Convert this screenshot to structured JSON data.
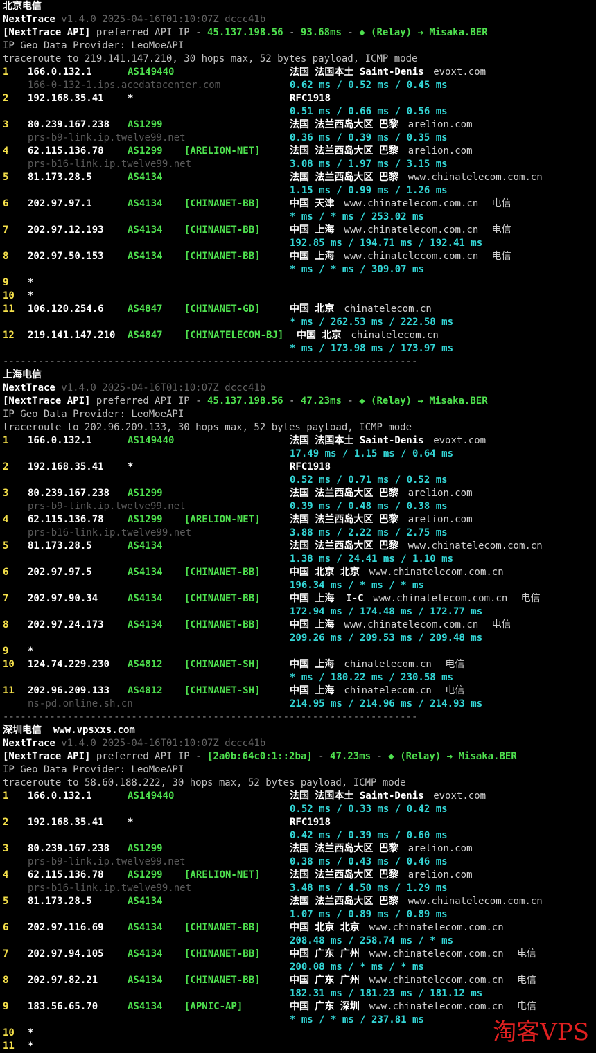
{
  "header": {
    "tool": "NextTrace",
    "version": "v1.4.0 2025-04-16T01:10:07Z dccc41b",
    "geo_provider": "IP Geo Data Provider: LeoMoeAPI"
  },
  "sections": [
    {
      "title": "北京电信",
      "site": "",
      "api_ip": "45.137.198.56",
      "api_latency": "93.68ms",
      "traceroute": "traceroute to 219.141.147.210, 30 hops max, 52 bytes payload, ICMP mode",
      "hops": [
        {
          "n": "1",
          "ip": "166.0.132.1",
          "asn": "AS149440",
          "tag": "",
          "geo": "法国 法国本土 Saint-Denis",
          "dom": "evoxt.com",
          "isp": "",
          "host": "166-0-132-1.ips.acedatacenter.com",
          "rtt": "0.62 ms / 0.52 ms / 0.45 ms"
        },
        {
          "n": "2",
          "ip": "192.168.35.41",
          "asn": "*",
          "tag": "",
          "geo": "RFC1918",
          "dom": "",
          "isp": "",
          "host": "",
          "rtt": "0.51 ms / 0.66 ms / 0.56 ms"
        },
        {
          "n": "3",
          "ip": "80.239.167.238",
          "asn": "AS1299",
          "tag": "",
          "geo": "法国 法兰西岛大区 巴黎",
          "dom": "arelion.com",
          "isp": "",
          "host": "prs-b9-link.ip.twelve99.net",
          "rtt": "0.36 ms / 0.39 ms / 0.35 ms"
        },
        {
          "n": "4",
          "ip": "62.115.136.78",
          "asn": "AS1299",
          "tag": "[ARELION-NET]",
          "geo": "法国 法兰西岛大区 巴黎",
          "dom": "arelion.com",
          "isp": "",
          "host": "prs-b16-link.ip.twelve99.net",
          "rtt": "3.08 ms / 1.97 ms / 3.15 ms"
        },
        {
          "n": "5",
          "ip": "81.173.28.5",
          "asn": "AS4134",
          "tag": "",
          "geo": "法国 法兰西岛大区 巴黎",
          "dom": "www.chinatelecom.com.cn",
          "isp": "",
          "host": "",
          "rtt": "1.15 ms / 0.99 ms / 1.26 ms"
        },
        {
          "n": "6",
          "ip": "202.97.97.1",
          "asn": "AS4134",
          "tag": "[CHINANET-BB]",
          "geo": "中国 天津",
          "dom": "www.chinatelecom.com.cn",
          "isp": "电信",
          "host": "",
          "rtt": "* ms / * ms / 253.02 ms"
        },
        {
          "n": "7",
          "ip": "202.97.12.193",
          "asn": "AS4134",
          "tag": "[CHINANET-BB]",
          "geo": "中国 上海",
          "dom": "www.chinatelecom.com.cn",
          "isp": "电信",
          "host": "",
          "rtt": "192.85 ms / 194.71 ms / 192.41 ms"
        },
        {
          "n": "8",
          "ip": "202.97.50.153",
          "asn": "AS4134",
          "tag": "[CHINANET-BB]",
          "geo": "中国 上海",
          "dom": "www.chinatelecom.com.cn",
          "isp": "电信",
          "host": "",
          "rtt": "* ms / * ms / 309.07 ms"
        },
        {
          "n": "9",
          "ip": "*"
        },
        {
          "n": "10",
          "ip": "*"
        },
        {
          "n": "11",
          "ip": "106.120.254.6",
          "asn": "AS4847",
          "tag": "[CHINANET-GD]",
          "geo": "中国 北京",
          "dom": "chinatelecom.cn",
          "isp": "",
          "host": "",
          "rtt": "* ms / 262.53 ms / 222.58 ms"
        },
        {
          "n": "12",
          "ip": "219.141.147.210",
          "asn": "AS4847",
          "tag": "[CHINATELECOM-BJ]",
          "geo": "中国 北京",
          "dom": "chinatelecom.cn",
          "isp": "",
          "host": "",
          "rtt": "* ms / 173.98 ms / 173.97 ms"
        }
      ]
    },
    {
      "title": "上海电信",
      "site": "",
      "api_ip": "45.137.198.56",
      "api_latency": "47.23ms",
      "traceroute": "traceroute to 202.96.209.133, 30 hops max, 52 bytes payload, ICMP mode",
      "hops": [
        {
          "n": "1",
          "ip": "166.0.132.1",
          "asn": "AS149440",
          "tag": "",
          "geo": "法国 法国本土 Saint-Denis",
          "dom": "evoxt.com",
          "isp": "",
          "host": "",
          "rtt": "17.49 ms / 1.15 ms / 0.64 ms"
        },
        {
          "n": "2",
          "ip": "192.168.35.41",
          "asn": "*",
          "tag": "",
          "geo": "RFC1918",
          "dom": "",
          "isp": "",
          "host": "",
          "rtt": "0.52 ms / 0.71 ms / 0.52 ms"
        },
        {
          "n": "3",
          "ip": "80.239.167.238",
          "asn": "AS1299",
          "tag": "",
          "geo": "法国 法兰西岛大区 巴黎",
          "dom": "arelion.com",
          "isp": "",
          "host": "prs-b9-link.ip.twelve99.net",
          "rtt": "0.39 ms / 0.48 ms / 0.38 ms"
        },
        {
          "n": "4",
          "ip": "62.115.136.78",
          "asn": "AS1299",
          "tag": "[ARELION-NET]",
          "geo": "法国 法兰西岛大区 巴黎",
          "dom": "arelion.com",
          "isp": "",
          "host": "prs-b16-link.ip.twelve99.net",
          "rtt": "3.88 ms / 2.22 ms / 2.75 ms"
        },
        {
          "n": "5",
          "ip": "81.173.28.5",
          "asn": "AS4134",
          "tag": "",
          "geo": "法国 法兰西岛大区 巴黎",
          "dom": "www.chinatelecom.com.cn",
          "isp": "",
          "host": "",
          "rtt": "1.38 ms / 24.41 ms / 1.10 ms"
        },
        {
          "n": "6",
          "ip": "202.97.97.5",
          "asn": "AS4134",
          "tag": "[CHINANET-BB]",
          "geo": "中国 北京 北京",
          "dom": "www.chinatelecom.com.cn",
          "isp": "",
          "host": "",
          "rtt": "196.34 ms / * ms / * ms"
        },
        {
          "n": "7",
          "ip": "202.97.90.34",
          "asn": "AS4134",
          "tag": "[CHINANET-BB]",
          "geo": "中国 上海  I-C",
          "dom": "www.chinatelecom.com.cn",
          "isp": "电信",
          "host": "",
          "rtt": "172.94 ms / 174.48 ms / 172.77 ms"
        },
        {
          "n": "8",
          "ip": "202.97.24.173",
          "asn": "AS4134",
          "tag": "[CHINANET-BB]",
          "geo": "中国 上海",
          "dom": "www.chinatelecom.com.cn",
          "isp": "电信",
          "host": "",
          "rtt": "209.26 ms / 209.53 ms / 209.48 ms"
        },
        {
          "n": "9",
          "ip": "*"
        },
        {
          "n": "10",
          "ip": "124.74.229.230",
          "asn": "AS4812",
          "tag": "[CHINANET-SH]",
          "geo": "中国 上海",
          "dom": "chinatelecom.cn",
          "isp": "电信",
          "host": "",
          "rtt": "* ms / 180.22 ms / 230.58 ms"
        },
        {
          "n": "11",
          "ip": "202.96.209.133",
          "asn": "AS4812",
          "tag": "[CHINANET-SH]",
          "geo": "中国 上海",
          "dom": "chinatelecom.cn",
          "isp": "电信",
          "host": "ns-pd.online.sh.cn",
          "rtt": "214.95 ms / 214.96 ms / 214.93 ms"
        }
      ]
    },
    {
      "title": "深圳电信",
      "site": "www.vpsxxs.com",
      "api_ip": "[2a0b:64c0:1::2ba]",
      "api_latency": "47.23ms",
      "traceroute": "traceroute to 58.60.188.222, 30 hops max, 52 bytes payload, ICMP mode",
      "hops": [
        {
          "n": "1",
          "ip": "166.0.132.1",
          "asn": "AS149440",
          "tag": "",
          "geo": "法国 法国本土 Saint-Denis",
          "dom": "evoxt.com",
          "isp": "",
          "host": "",
          "rtt": "0.52 ms / 0.33 ms / 0.42 ms"
        },
        {
          "n": "2",
          "ip": "192.168.35.41",
          "asn": "*",
          "tag": "",
          "geo": "RFC1918",
          "dom": "",
          "isp": "",
          "host": "",
          "rtt": "0.42 ms / 0.39 ms / 0.60 ms"
        },
        {
          "n": "3",
          "ip": "80.239.167.238",
          "asn": "AS1299",
          "tag": "",
          "geo": "法国 法兰西岛大区 巴黎",
          "dom": "arelion.com",
          "isp": "",
          "host": "prs-b9-link.ip.twelve99.net",
          "rtt": "0.38 ms / 0.43 ms / 0.46 ms"
        },
        {
          "n": "4",
          "ip": "62.115.136.78",
          "asn": "AS1299",
          "tag": "[ARELION-NET]",
          "geo": "法国 法兰西岛大区 巴黎",
          "dom": "arelion.com",
          "isp": "",
          "host": "prs-b16-link.ip.twelve99.net",
          "rtt": "3.48 ms / 4.50 ms / 1.29 ms"
        },
        {
          "n": "5",
          "ip": "81.173.28.5",
          "asn": "AS4134",
          "tag": "",
          "geo": "法国 法兰西岛大区 巴黎",
          "dom": "www.chinatelecom.com.cn",
          "isp": "",
          "host": "",
          "rtt": "1.07 ms / 0.89 ms / 0.89 ms"
        },
        {
          "n": "6",
          "ip": "202.97.116.69",
          "asn": "AS4134",
          "tag": "[CHINANET-BB]",
          "geo": "中国 北京 北京",
          "dom": "www.chinatelecom.com.cn",
          "isp": "",
          "host": "",
          "rtt": "208.48 ms / 258.74 ms / * ms"
        },
        {
          "n": "7",
          "ip": "202.97.94.105",
          "asn": "AS4134",
          "tag": "[CHINANET-BB]",
          "geo": "中国 广东 广州",
          "dom": "www.chinatelecom.com.cn",
          "isp": "电信",
          "host": "",
          "rtt": "200.08 ms / * ms / * ms"
        },
        {
          "n": "8",
          "ip": "202.97.82.21",
          "asn": "AS4134",
          "tag": "[CHINANET-BB]",
          "geo": "中国 广东 广州",
          "dom": "www.chinatelecom.com.cn",
          "isp": "电信",
          "host": "",
          "rtt": "182.31 ms / 181.23 ms / 181.12 ms"
        },
        {
          "n": "9",
          "ip": "183.56.65.70",
          "asn": "AS4134",
          "tag": "[APNIC-AP]",
          "geo": "中国 广东 深圳",
          "dom": "www.chinatelecom.com.cn",
          "isp": "电信",
          "host": "",
          "rtt": "* ms / * ms / 237.81 ms"
        },
        {
          "n": "10",
          "ip": "*"
        },
        {
          "n": "11",
          "ip": "*"
        }
      ]
    }
  ],
  "relay_label": "(Relay)",
  "relay_target": "Misaka.BER",
  "api_prefix": "[NextTrace API]",
  "separator": "-----------------------------------------------------------------------",
  "watermark": "淘客VPS",
  "colors": {
    "hop_number": "#f5e04a",
    "asn": "#4ee04e",
    "rtt": "#33d6d6",
    "hostname": "#5a5a5a",
    "watermark": "#e02020"
  }
}
